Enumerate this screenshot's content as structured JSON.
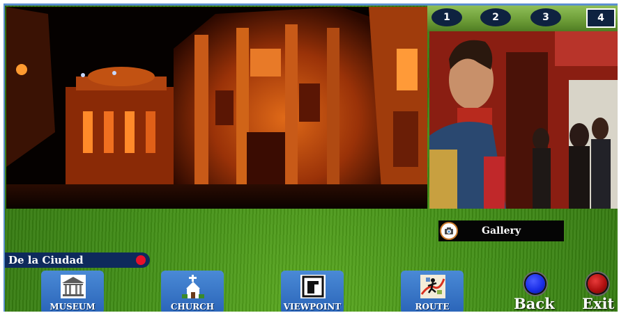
{
  "thumbnails": [
    "1",
    "2",
    "3",
    "4"
  ],
  "gallery": {
    "label": "Gallery",
    "icon": "camera-icon"
  },
  "location": {
    "name": "De la Ciudad"
  },
  "nav": {
    "museum": "MUSEUM",
    "church": "CHURCH",
    "viewpoint": "VIEWPOINT",
    "route": "ROUTE"
  },
  "controls": {
    "back": "Back",
    "exit": "Exit"
  },
  "colors": {
    "frame_border": "#5b8fd0",
    "nav_button": "#2a64b8",
    "location_bar": "#0e2a5c",
    "location_dot": "#e8102a",
    "back_button": "#1a2ee8",
    "exit_button": "#b01010"
  }
}
